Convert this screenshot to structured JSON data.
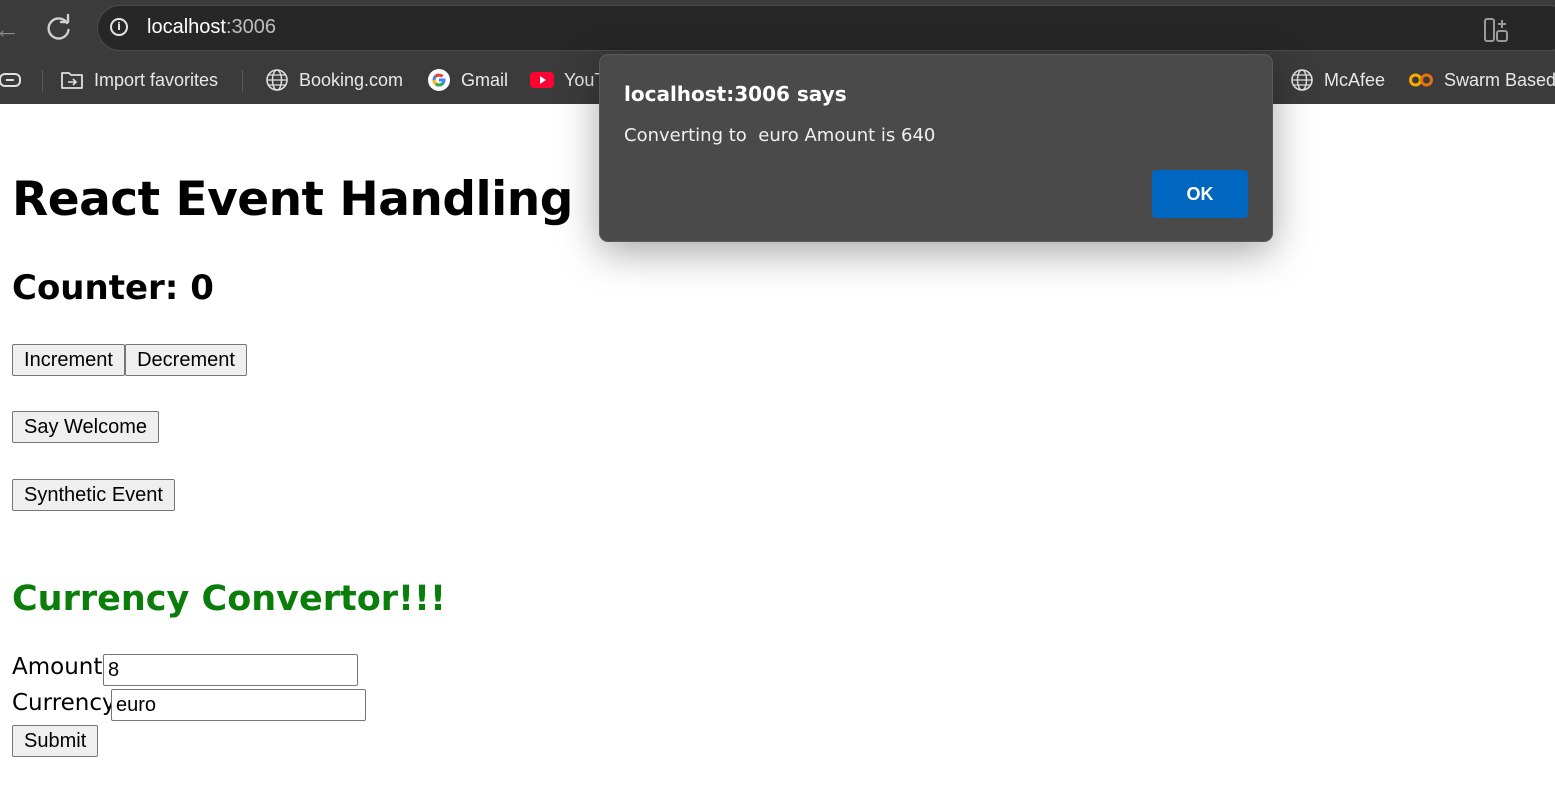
{
  "browser": {
    "url_host": "localhost",
    "url_port": ":3006",
    "bookmarks": {
      "import_favorites": "Import favorites",
      "booking": "Booking.com",
      "gmail": "Gmail",
      "youtube": "YouT",
      "mcafee": "McAfee",
      "swarm": "Swarm Based T"
    },
    "colors": {
      "chrome_bg": "#3b3b3b",
      "omnibox_bg": "#272727"
    }
  },
  "page": {
    "title": "React Event Handling",
    "counter_label": "Counter: 0",
    "buttons": {
      "increment": "Increment",
      "decrement": "Decrement",
      "say_welcome": "Say Welcome",
      "synthetic_event": "Synthetic Event"
    },
    "currency": {
      "title": "Currency Convertor!!!",
      "title_color": "#0a7d0a",
      "amount_label": "Amount:",
      "amount_value": "8",
      "currency_label": "Currency:",
      "currency_value": "euro",
      "submit_label": "Submit"
    }
  },
  "dialog": {
    "title": "localhost:3006 says",
    "message": "Converting to  euro Amount is 640",
    "ok_label": "OK",
    "ok_color": "#0067c0"
  }
}
